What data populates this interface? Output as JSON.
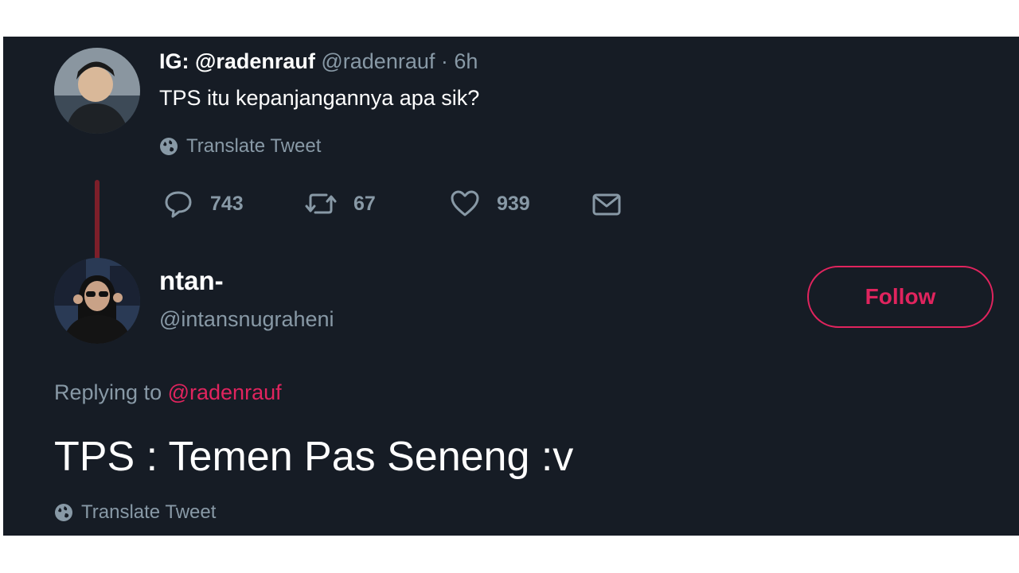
{
  "tweet1": {
    "display_name": "IG: @radenrauf",
    "handle": "@radenrauf",
    "time": "· 6h",
    "text": "TPS itu kepanjangannya apa sik?",
    "translate_label": "Translate Tweet",
    "replies": "743",
    "retweets": "67",
    "likes": "939",
    "icons": [
      "globe-icon",
      "reply-icon",
      "retweet-icon",
      "like-icon",
      "message-icon"
    ]
  },
  "tweet2": {
    "display_name": "ntan-",
    "handle": "@intansnugraheni",
    "follow_label": "Follow",
    "replying_to_label": "Replying to",
    "replying_to_handle": "@radenrauf",
    "text": "TPS : Temen Pas Seneng :v",
    "translate_label": "Translate Tweet"
  },
  "colors": {
    "background": "#161c25",
    "accent": "#e0245e",
    "muted": "#8899a6",
    "thread_line": "#7c1f2a"
  }
}
